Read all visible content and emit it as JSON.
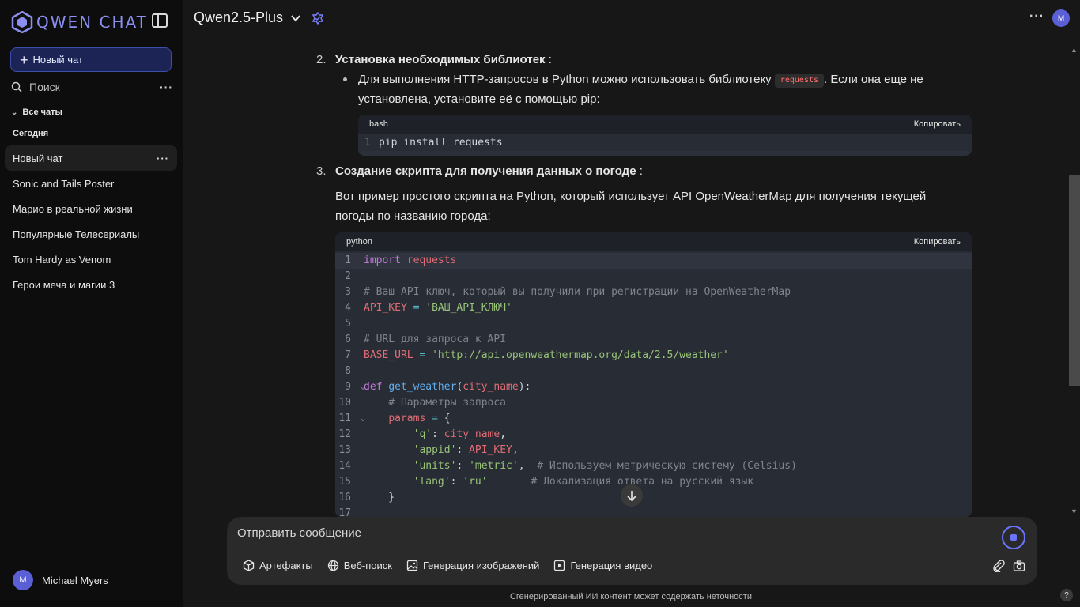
{
  "app": {
    "logo_text": "QWEN CHAT"
  },
  "sidebar": {
    "new_chat_label": "Новый чат",
    "search_placeholder": "Поиск",
    "all_chats_label": "Все чаты",
    "section_today": "Сегодня",
    "chats": [
      {
        "title": "Новый чат",
        "active": true
      },
      {
        "title": "Sonic and Tails Poster"
      },
      {
        "title": "Марио в реальной жизни"
      },
      {
        "title": "Популярные Телесериалы"
      },
      {
        "title": "Tom Hardy as Venom"
      },
      {
        "title": "Герои меча и магии 3"
      }
    ],
    "user": {
      "name": "Michael Myers",
      "initial": "M"
    }
  },
  "header": {
    "model_name": "Qwen2.5-Plus",
    "avatar_initial": "M"
  },
  "message": {
    "step2": {
      "number": "2.",
      "title": "Установка необходимых библиотек",
      "suffix": " :"
    },
    "step2_bullet": {
      "text_before": "Для выполнения HTTP-запросов в Python можно использовать библиотеку ",
      "inline_code": "requests",
      "text_after": ". Если она еще не установлена, установите её с помощью pip:"
    },
    "bash_block": {
      "language": "bash",
      "copy_label": "Копировать",
      "lines": [
        {
          "n": "1",
          "code": "pip install requests"
        }
      ]
    },
    "step3": {
      "number": "3.",
      "title": "Создание скрипта для получения данных о погоде",
      "suffix": " :"
    },
    "step3_text": "Вот пример простого скрипта на Python, который использует API OpenWeatherMap для получения текущей погоды по названию города:",
    "python_block": {
      "language": "python",
      "copy_label": "Копировать",
      "line_numbers": [
        "1",
        "2",
        "3",
        "4",
        "5",
        "6",
        "7",
        "8",
        "9",
        "10",
        "11",
        "12",
        "13",
        "14",
        "15",
        "16",
        "17"
      ]
    }
  },
  "composer": {
    "placeholder": "Отправить сообщение",
    "tools": [
      "Артефакты",
      "Веб-поиск",
      "Генерация изображений",
      "Генерация видео"
    ]
  },
  "footer": {
    "disclaimer": "Сгенерированный ИИ контент может содержать неточности.",
    "help": "?"
  }
}
